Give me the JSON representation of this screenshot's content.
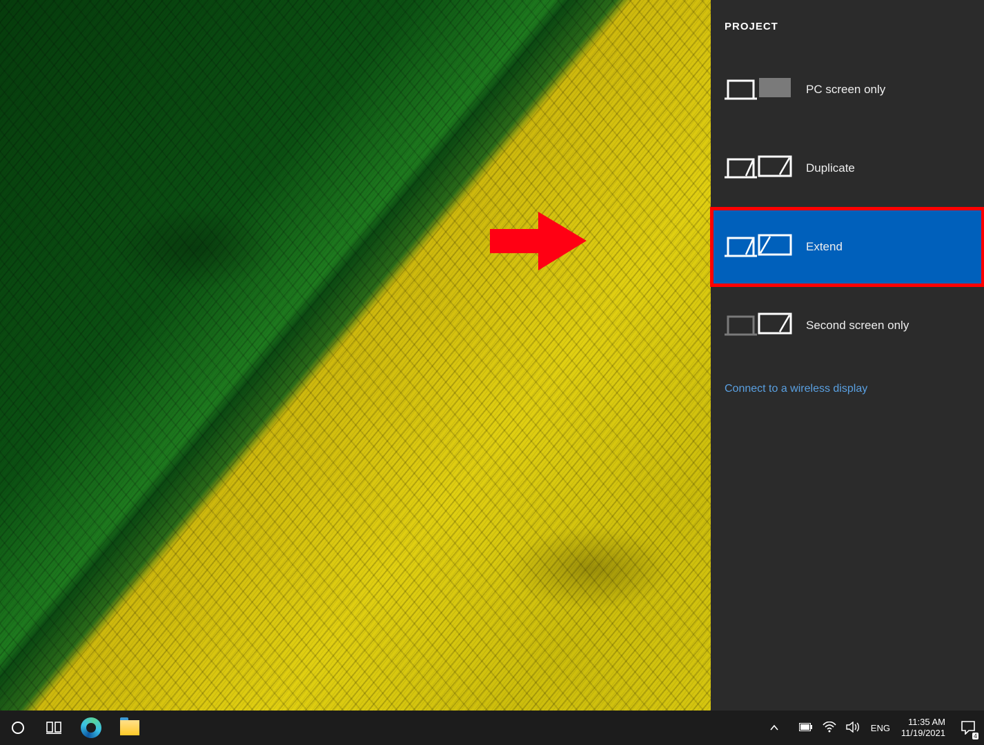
{
  "panel": {
    "title": "PROJECT",
    "options": [
      {
        "label": "PC screen only",
        "selected": false
      },
      {
        "label": "Duplicate",
        "selected": false
      },
      {
        "label": "Extend",
        "selected": true
      },
      {
        "label": "Second screen only",
        "selected": false
      }
    ],
    "wireless_link": "Connect to a wireless display"
  },
  "taskbar": {
    "language": "ENG",
    "time": "11:35 AM",
    "date": "11/19/2021",
    "notification_count": "4"
  }
}
